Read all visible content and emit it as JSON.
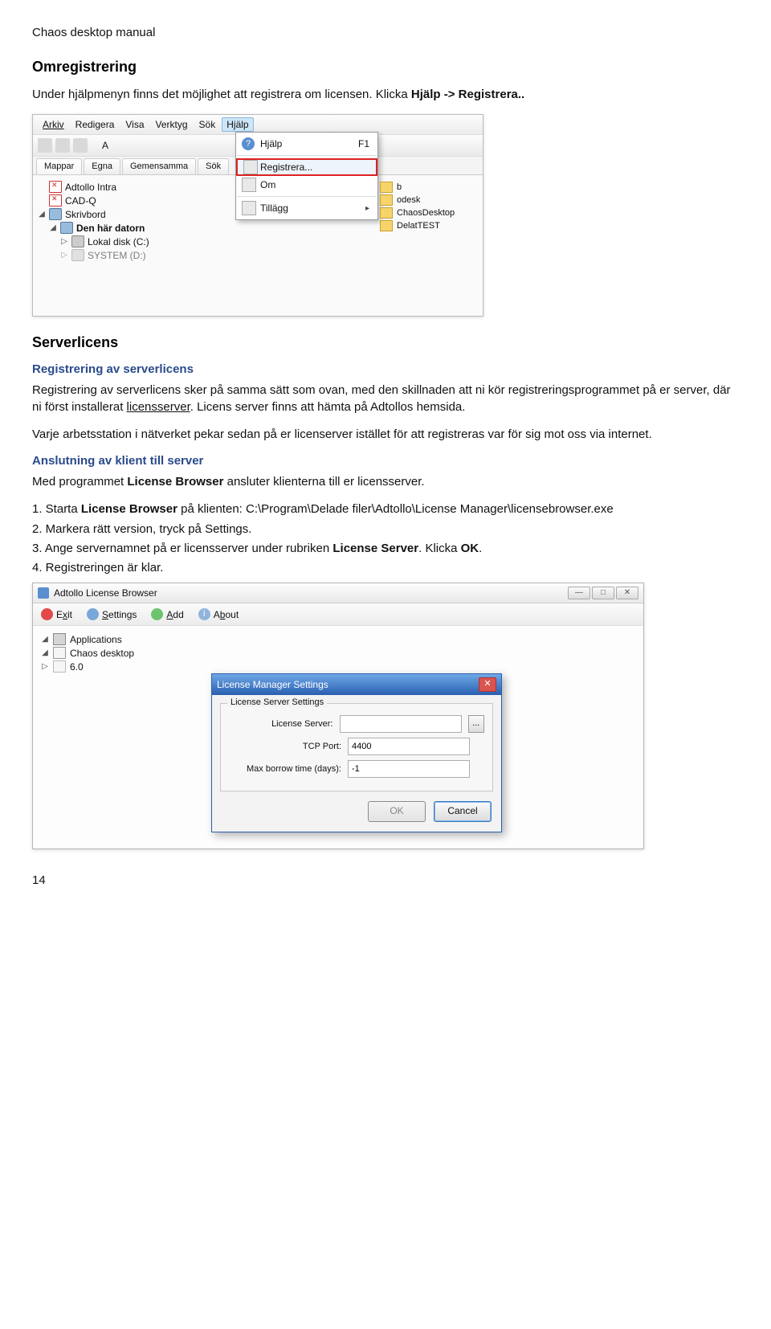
{
  "doc": {
    "header": "Chaos desktop manual",
    "s1_title": "Omregistrering",
    "s1_p_a": "Under hjälpmenyn finns det möjlighet att registrera om licensen. Klicka ",
    "s1_p_b": "Hjälp -> Registrera..",
    "s2_title": "Serverlicens",
    "s2_sub1": "Registrering av serverlicens",
    "s2_p1_a": "Registrering av serverlicens sker på samma sätt som ovan, med den skillnaden att ni kör registreringsprogrammet på er server, där ni först installerat ",
    "s2_p1_u": "licensserver",
    "s2_p1_b": ". Licens server finns att hämta på Adtollos hemsida.",
    "s2_p2": "Varje arbetsstation i nätverket pekar sedan på er licenserver istället för att registreras var för sig mot oss via internet.",
    "s2_sub2": "Anslutning av klient till server",
    "s2_p3_a": "Med programmet ",
    "s2_p3_b": "License Browser",
    "s2_p3_c": " ansluter klienterna till er licensserver.",
    "li1_a": "1. Starta ",
    "li1_b": "License Browser",
    "li1_c": " på klienten: C:\\Program\\Delade filer\\Adtollo\\License Manager\\licensebrowser.exe",
    "li2": "2. Markera rätt version, tryck på Settings.",
    "li3_a": "3. Ange servernamnet på er licensserver under rubriken ",
    "li3_b": "License Server",
    "li3_c": ". Klicka ",
    "li3_d": "OK",
    "li3_e": ".",
    "li4": "4. Registreringen är klar.",
    "page": "14"
  },
  "shot1": {
    "menu": {
      "arkiv": "Arkiv",
      "redigera": "Redigera",
      "visa": "Visa",
      "verktyg": "Verktyg",
      "sok": "Sök",
      "hjalp": "Hjälp"
    },
    "tool_a": "A",
    "tabs": {
      "mappar": "Mappar",
      "egna": "Egna",
      "gemensamma": "Gemensamma",
      "sok": "Sök"
    },
    "tree": {
      "adtollo": "Adtollo Intra",
      "cadq": "CAD-Q",
      "skrivbord": "Skrivbord",
      "denhar": "Den här datorn",
      "lokal": "Lokal disk (C:)",
      "system": "SYSTEM (D:)"
    },
    "dropdown": {
      "hjalp": "Hjälp",
      "f1": "F1",
      "registrera": "Registrera...",
      "om": "Om",
      "tillagg": "Tillägg"
    },
    "flist": {
      "b": "b",
      "odesk": "odesk",
      "chaos": "ChaosDesktop",
      "delat": "DelatTEST"
    }
  },
  "shot2": {
    "title": "Adtollo License Browser",
    "toolbar": {
      "exit": "Exit",
      "settings": "Settings",
      "add": "Add",
      "about": "About"
    },
    "exit_key": "x",
    "set_key": "S",
    "add_key": "A",
    "about_key": "b",
    "tree": {
      "apps": "Applications",
      "chaos": "Chaos desktop",
      "ver": "6.0"
    },
    "dlg": {
      "title": "License Manager Settings",
      "group": "License Server Settings",
      "l_server": "License Server:",
      "l_port": "TCP Port:",
      "l_borrow": "Max borrow time (days):",
      "v_server": "",
      "v_port": "4400",
      "v_borrow": "-1",
      "browse": "...",
      "ok": "OK",
      "cancel": "Cancel"
    },
    "win": {
      "min": "—",
      "max": "□",
      "close": "✕"
    }
  }
}
